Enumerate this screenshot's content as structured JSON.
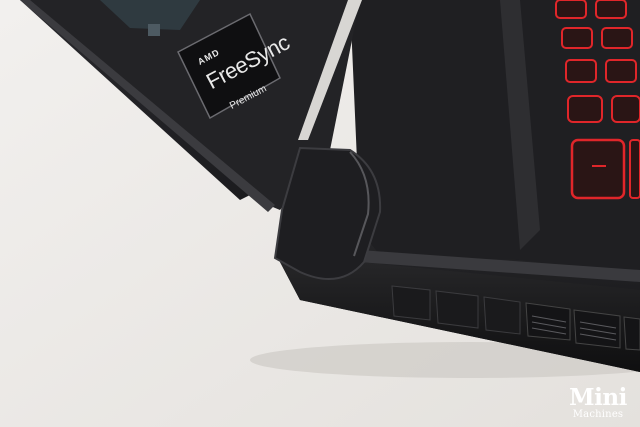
{
  "photo": {
    "subject": "laptop-hinge-closeup",
    "sticker": {
      "brand": "AMD",
      "product": "FreeSync",
      "tier": "Premium"
    },
    "watermark": {
      "title": "Mini",
      "subtitle": "Machines"
    },
    "colors": {
      "background": "#ebe9e6",
      "chassis": "#1b1b1d",
      "keyboard_backlight": "#e0262a"
    }
  }
}
